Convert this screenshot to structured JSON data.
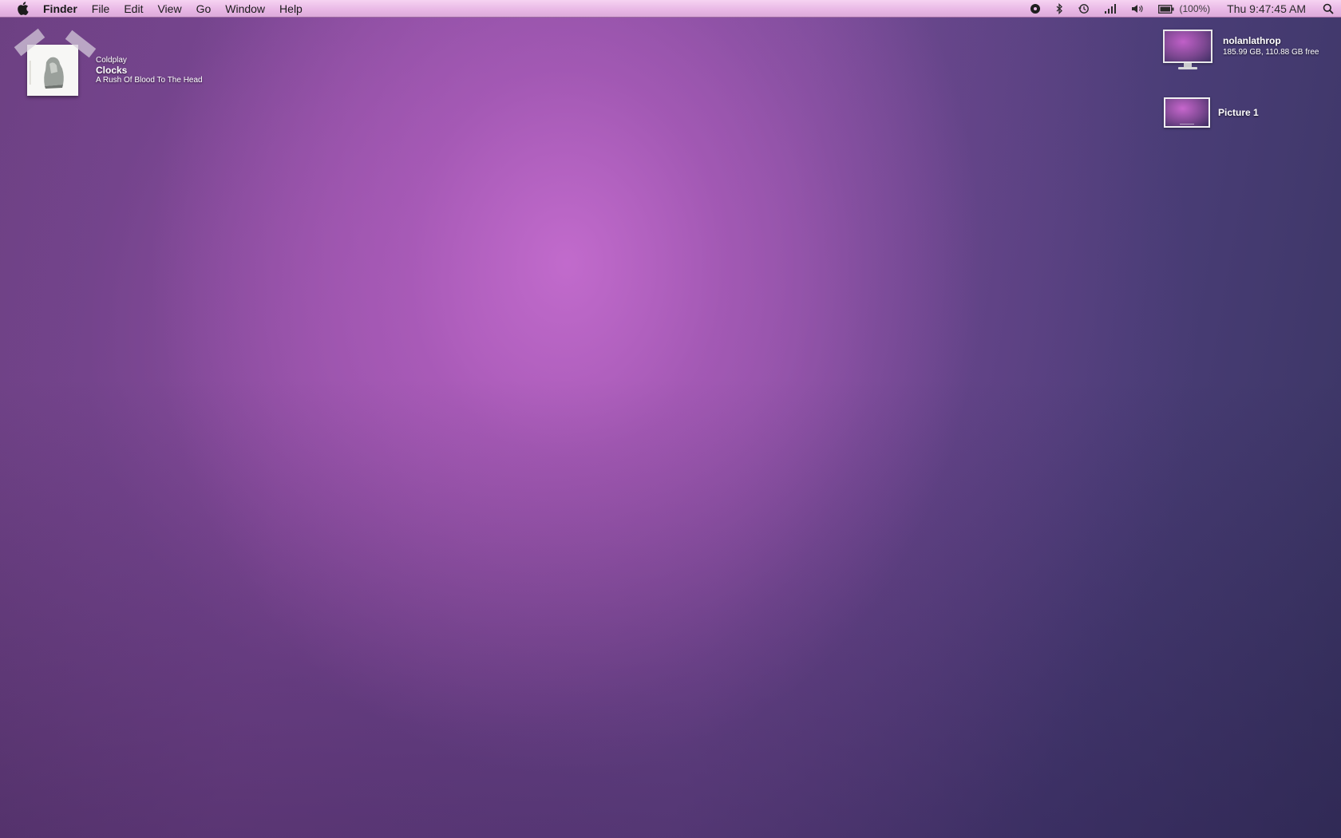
{
  "menubar": {
    "app_name": "Finder",
    "menus": [
      "File",
      "Edit",
      "View",
      "Go",
      "Window",
      "Help"
    ],
    "status_icons": [
      "record-icon",
      "bluetooth-icon",
      "time-machine-icon",
      "wifi-signal-icon",
      "volume-icon",
      "battery-icon"
    ],
    "battery_percent": "(100%)",
    "clock": "Thu 9:47:45 AM"
  },
  "now_playing": {
    "artist": "Coldplay",
    "title": "Clocks",
    "album": "A Rush Of Blood To The Head"
  },
  "desktop": {
    "hard_drive": {
      "name": "nolanlathrop",
      "info": "185.99 GB, 110.88 GB free"
    },
    "picture": {
      "name": "Picture 1"
    }
  },
  "colors": {
    "menubar": "#e9b9e6",
    "wallpaper_center": "#c46cce",
    "wallpaper_edge": "#3a3563"
  }
}
